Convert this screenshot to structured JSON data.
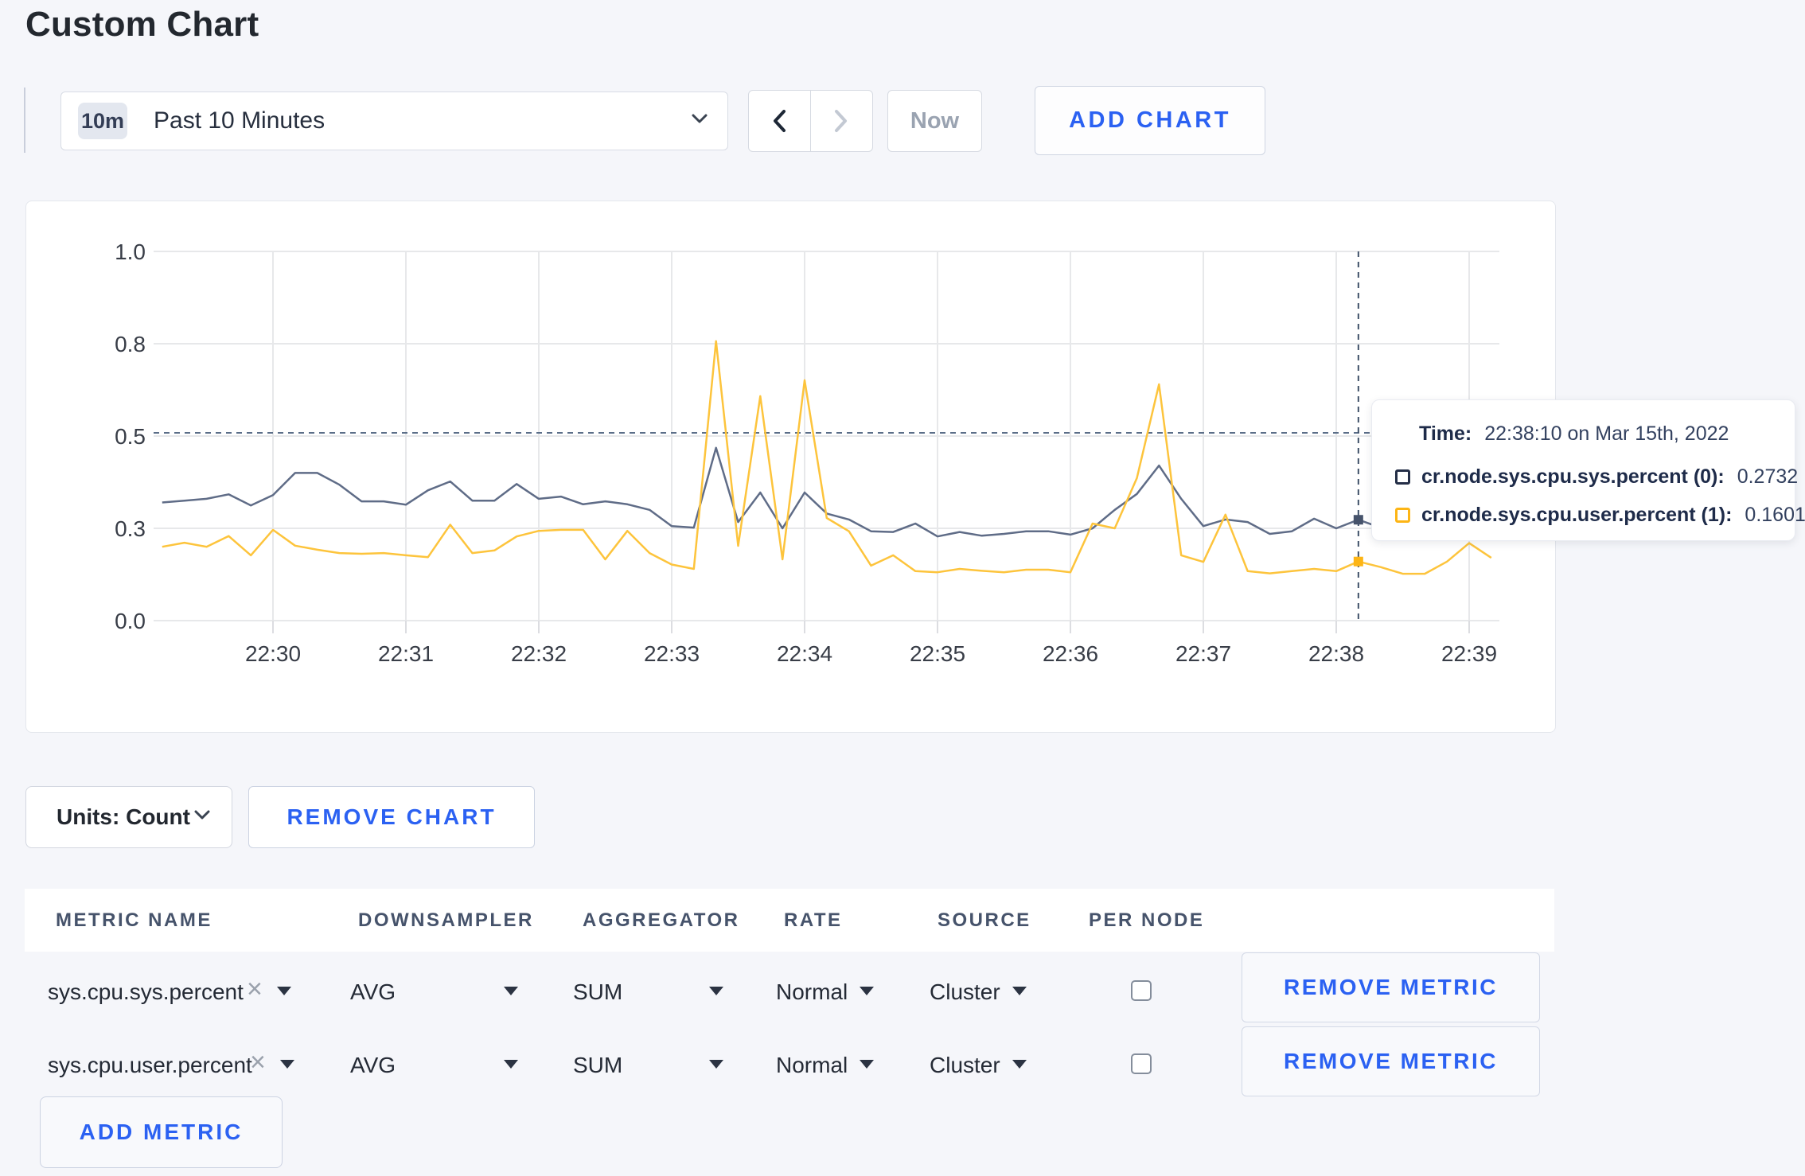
{
  "title": "Custom Chart",
  "time_controls": {
    "range_badge": "10m",
    "range_label": "Past 10 Minutes",
    "now_label": "Now",
    "add_chart_label": "ADD CHART"
  },
  "chart_data": {
    "type": "line",
    "title": "",
    "xlabel": "",
    "ylabel": "",
    "ylim": [
      0,
      1
    ],
    "grid": true,
    "y_ticks": [
      {
        "v": 0.0,
        "label": "0.0"
      },
      {
        "v": 0.25,
        "label": "0.3"
      },
      {
        "v": 0.5,
        "label": "0.5"
      },
      {
        "v": 0.75,
        "label": "0.8"
      },
      {
        "v": 1.0,
        "label": "1.0"
      }
    ],
    "x_tick_labels": [
      "22:30",
      "22:31",
      "22:32",
      "22:33",
      "22:34",
      "22:35",
      "22:36",
      "22:37",
      "22:38",
      "22:39"
    ],
    "x_start_sec": -50,
    "x_step_sec": 10,
    "series": [
      {
        "name": "cr.node.sys.cpu.sys.percent",
        "color": "#5f6c87",
        "values": [
          0.32,
          0.325,
          0.33,
          0.342,
          0.312,
          0.34,
          0.4,
          0.4,
          0.368,
          0.323,
          0.323,
          0.314,
          0.353,
          0.377,
          0.325,
          0.325,
          0.37,
          0.33,
          0.336,
          0.315,
          0.323,
          0.315,
          0.3,
          0.256,
          0.252,
          0.468,
          0.267,
          0.347,
          0.25,
          0.347,
          0.29,
          0.274,
          0.242,
          0.24,
          0.263,
          0.228,
          0.24,
          0.23,
          0.235,
          0.242,
          0.242,
          0.233,
          0.25,
          0.3,
          0.343,
          0.42,
          0.33,
          0.256,
          0.274,
          0.267,
          0.235,
          0.242,
          0.276,
          0.25,
          0.2732,
          0.252,
          0.248,
          0.26,
          0.255,
          0.25,
          0.252
        ]
      },
      {
        "name": "cr.node.sys.cpu.user.percent",
        "color": "#fdc43c",
        "values": [
          0.2,
          0.211,
          0.2,
          0.229,
          0.177,
          0.246,
          0.203,
          0.192,
          0.183,
          0.181,
          0.183,
          0.177,
          0.172,
          0.26,
          0.183,
          0.19,
          0.228,
          0.243,
          0.246,
          0.246,
          0.166,
          0.243,
          0.183,
          0.152,
          0.14,
          0.757,
          0.2025,
          0.608,
          0.166,
          0.651,
          0.278,
          0.242,
          0.149,
          0.177,
          0.134,
          0.131,
          0.14,
          0.135,
          0.131,
          0.138,
          0.138,
          0.131,
          0.263,
          0.25,
          0.386,
          0.64,
          0.177,
          0.159,
          0.287,
          0.134,
          0.128,
          0.134,
          0.14,
          0.134,
          0.1601,
          0.145,
          0.127,
          0.127,
          0.16,
          0.21,
          0.17
        ]
      }
    ],
    "crosshair": {
      "x_sec": 490,
      "y_value": 0.5086,
      "marker_values": [
        0.2732,
        0.1601
      ]
    }
  },
  "tooltip": {
    "time_label": "Time:",
    "time_value": "22:38:10 on Mar 15th, 2022",
    "rows": [
      {
        "label": "cr.node.sys.cpu.sys.percent (0):",
        "value": "0.2732",
        "color": "#242e47"
      },
      {
        "label": "cr.node.sys.cpu.user.percent (1):",
        "value": "0.1601",
        "color": "#fdb515"
      }
    ]
  },
  "units_bar": {
    "units_label": "Units: Count",
    "remove_chart_label": "REMOVE CHART"
  },
  "table": {
    "headers": [
      "METRIC NAME",
      "DOWNSAMPLER",
      "AGGREGATOR",
      "RATE",
      "SOURCE",
      "PER NODE"
    ],
    "rows": [
      {
        "metric": "sys.cpu.sys.percent",
        "downsampler": "AVG",
        "aggregator": "SUM",
        "rate": "Normal",
        "source": "Cluster",
        "per_node": false
      },
      {
        "metric": "sys.cpu.user.percent",
        "downsampler": "AVG",
        "aggregator": "SUM",
        "rate": "Normal",
        "source": "Cluster",
        "per_node": false
      }
    ],
    "remove_metric_label": "REMOVE METRIC",
    "add_metric_label": "ADD METRIC"
  }
}
